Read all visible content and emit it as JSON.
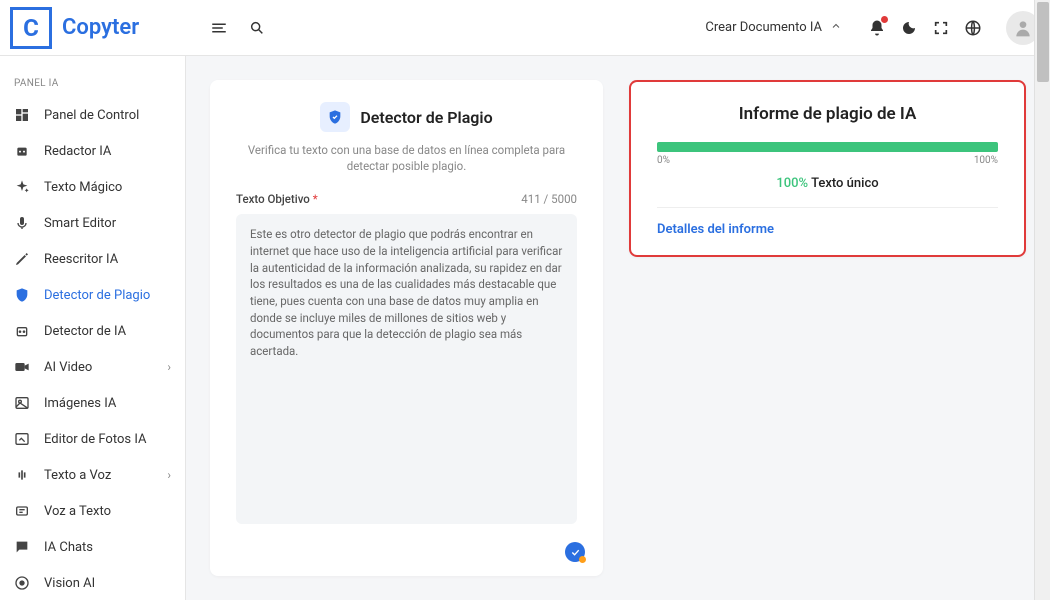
{
  "brand": {
    "letter": "C",
    "name": "Copyter"
  },
  "header": {
    "create_label": "Crear Documento IA"
  },
  "sidebar": {
    "section": "PANEL IA",
    "items": [
      {
        "label": "Panel de Control",
        "icon": "dashboard",
        "chev": false
      },
      {
        "label": "Redactor IA",
        "icon": "robot",
        "chev": false
      },
      {
        "label": "Texto Mágico",
        "icon": "sparkle",
        "chev": false
      },
      {
        "label": "Smart Editor",
        "icon": "mic",
        "chev": false
      },
      {
        "label": "Reescritor IA",
        "icon": "pen",
        "chev": false
      },
      {
        "label": "Detector de Plagio",
        "icon": "shield",
        "chev": false,
        "active": true
      },
      {
        "label": "Detector de IA",
        "icon": "robot2",
        "chev": false
      },
      {
        "label": "AI Video",
        "icon": "video",
        "chev": true
      },
      {
        "label": "Imágenes IA",
        "icon": "image",
        "chev": false
      },
      {
        "label": "Editor de Fotos IA",
        "icon": "photo",
        "chev": false
      },
      {
        "label": "Texto a Voz",
        "icon": "wave",
        "chev": true
      },
      {
        "label": "Voz a Texto",
        "icon": "wave2",
        "chev": false
      },
      {
        "label": "IA Chats",
        "icon": "chat",
        "chev": false
      },
      {
        "label": "Vision AI",
        "icon": "eye",
        "chev": false
      }
    ]
  },
  "detector": {
    "title": "Detector de Plagio",
    "subtitle": "Verifica tu texto con una base de datos en línea completa para detectar posible plagio.",
    "field_label": "Texto Objetivo",
    "counter": "411 / 5000",
    "text": "Este es otro detector de plagio que podrás encontrar en internet que hace uso de la inteligencia artificial para verificar la autenticidad de la información analizada, su rapidez en dar los resultados es una de las cualidades más destacable que tiene, pues cuenta con una base de datos muy amplia en donde se incluye miles de millones de sitios web y documentos para que la detección de plagio sea más acertada."
  },
  "report": {
    "title": "Informe de plagio de IA",
    "min": "0%",
    "max": "100%",
    "pct": "100%",
    "unique": "Texto único",
    "details": "Detalles del informe"
  }
}
